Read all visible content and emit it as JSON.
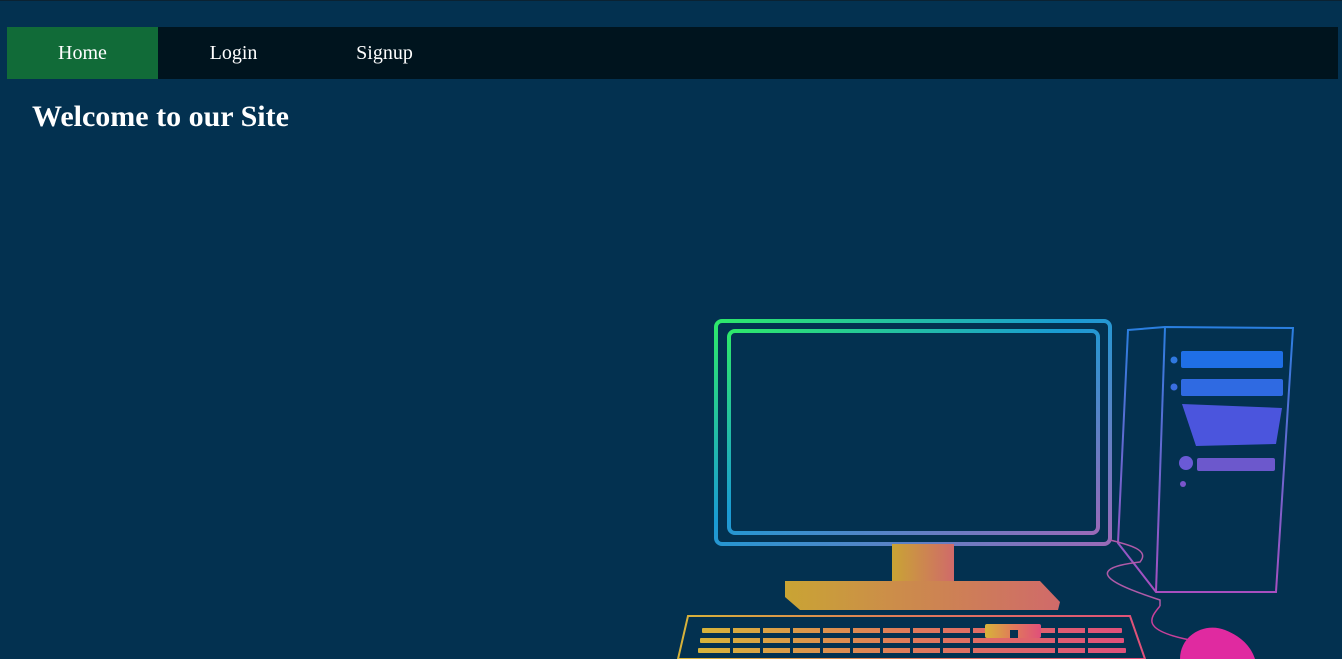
{
  "nav": {
    "items": [
      {
        "label": "Home",
        "active": true
      },
      {
        "label": "Login",
        "active": false
      },
      {
        "label": "Signup",
        "active": false
      }
    ]
  },
  "main": {
    "heading": "Welcome to our Site"
  },
  "colors": {
    "background": "#033150",
    "navbar": "#00141e",
    "nav_active": "#116b38",
    "text": "#ffffff"
  },
  "illustration": {
    "icon": "computer-desktop-icon"
  }
}
